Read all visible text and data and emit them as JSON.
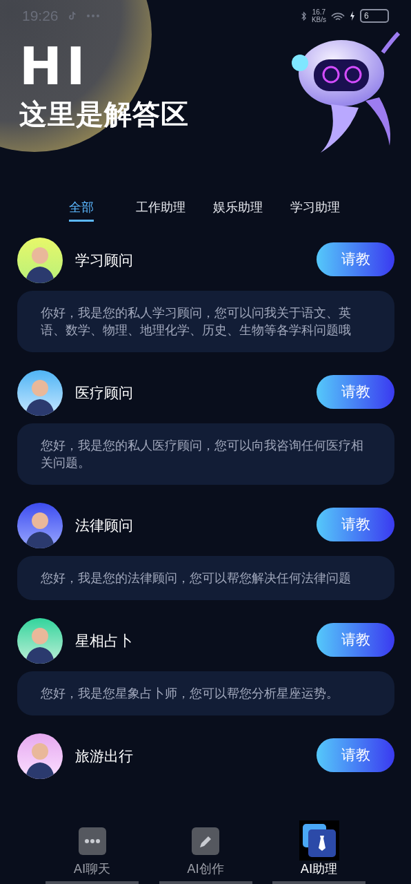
{
  "status_bar": {
    "time": "19:26",
    "speed_value": "16.7",
    "speed_unit": "KB/s",
    "battery": "6"
  },
  "header": {
    "title": "HI",
    "subtitle": "这里是解答区"
  },
  "tabs": [
    {
      "label": "全部",
      "selected": true
    },
    {
      "label": "工作助理",
      "selected": false
    },
    {
      "label": "娱乐助理",
      "selected": false
    },
    {
      "label": "学习助理",
      "selected": false
    }
  ],
  "assistants": [
    {
      "name": "学习顾问",
      "button": "请教",
      "description": "你好，我是您的私人学习顾问，您可以问我关于语文、英语、数学、物理、地理化学、历史、生物等各学科问题哦"
    },
    {
      "name": "医疗顾问",
      "button": "请教",
      "description": "您好，我是您的私人医疗顾问，您可以向我咨询任何医疗相关问题。"
    },
    {
      "name": "法律顾问",
      "button": "请教",
      "description": "您好，我是您的法律顾问，您可以帮您解决任何法律问题"
    },
    {
      "name": "星相占卜",
      "button": "请教",
      "description": "您好，我是您星象占卜师，您可以帮您分析星座运势。"
    },
    {
      "name": "旅游出行",
      "button": "请教"
    }
  ],
  "bottom_nav": [
    {
      "label": "AI聊天",
      "kind": "chat",
      "selected": false
    },
    {
      "label": "AI创作",
      "kind": "create",
      "selected": false
    },
    {
      "label": "AI助理",
      "kind": "assistant",
      "selected": true
    }
  ]
}
